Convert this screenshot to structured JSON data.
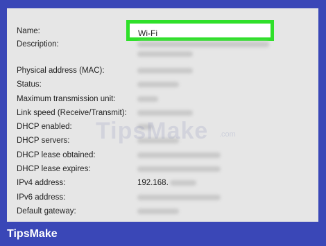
{
  "rows": [
    {
      "label": "Name:",
      "value": "Wi-Fi"
    },
    {
      "label": "Description:",
      "value": ""
    },
    {
      "label": "Physical address (MAC):",
      "value": ""
    },
    {
      "label": "Status:",
      "value": ""
    },
    {
      "label": "Maximum transmission unit:",
      "value": ""
    },
    {
      "label": "Link speed (Receive/Transmit):",
      "value": ""
    },
    {
      "label": "DHCP enabled:",
      "value": ""
    },
    {
      "label": "DHCP servers:",
      "value": ""
    },
    {
      "label": "DHCP lease obtained:",
      "value": ""
    },
    {
      "label": "DHCP lease expires:",
      "value": ""
    },
    {
      "label": "IPv4 address:",
      "value": "192.168."
    },
    {
      "label": "IPv6 address:",
      "value": ""
    },
    {
      "label": "Default gateway:",
      "value": ""
    }
  ],
  "watermark": {
    "main": "TipsMake",
    "suffix": ".com"
  },
  "footer": {
    "brand": "TipsMake"
  },
  "colors": {
    "highlight": "#2fe02a",
    "background": "#3a47b7",
    "panel": "#e6e6e6"
  }
}
